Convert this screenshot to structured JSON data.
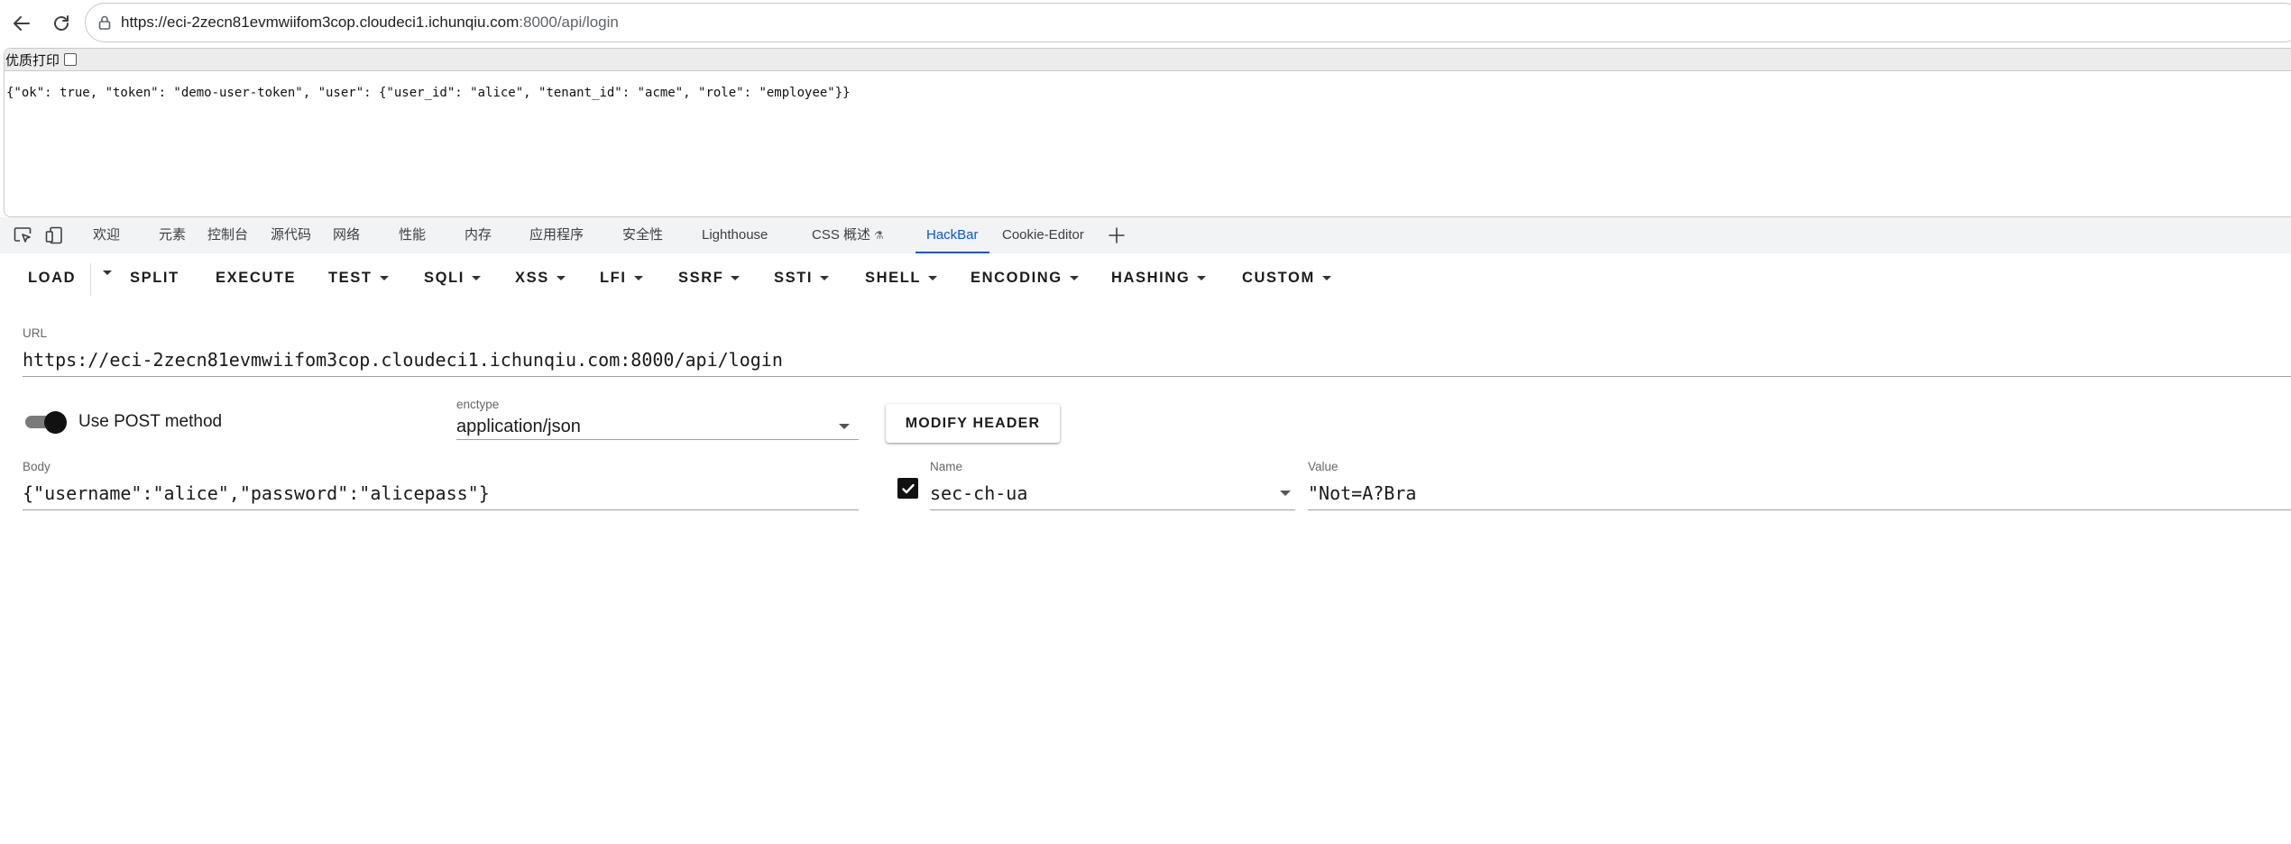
{
  "browser": {
    "url_main": "https://eci-2zecn81evmwiifom3cop.cloudeci1.ichunqiu.com",
    "url_rest": ":8000/api/login"
  },
  "page": {
    "print_label": "优质打印",
    "json_text": "{\"ok\": true, \"token\": \"demo-user-token\", \"user\": {\"user_id\": \"alice\", \"tenant_id\": \"acme\", \"role\": \"employee\"}}"
  },
  "devtools": {
    "tabs": [
      "欢迎",
      "元素",
      "控制台",
      "源代码",
      "网络",
      "性能",
      "内存",
      "应用程序",
      "安全性",
      "Lighthouse",
      "CSS 概述",
      "HackBar",
      "Cookie-Editor"
    ],
    "active_tab": "HackBar"
  },
  "hackbar": {
    "menu": {
      "load": "LOAD",
      "split": "SPLIT",
      "execute": "EXECUTE",
      "test": "TEST",
      "sqli": "SQLI",
      "xss": "XSS",
      "lfi": "LFI",
      "ssrf": "SSRF",
      "ssti": "SSTI",
      "shell": "SHELL",
      "encoding": "ENCODING",
      "hashing": "HASHING",
      "custom": "CUSTOM"
    },
    "url_label": "URL",
    "url_value": "https://eci-2zecn81evmwiifom3cop.cloudeci1.ichunqiu.com:8000/api/login",
    "post_label": "Use POST method",
    "post_enabled": true,
    "enctype_label": "enctype",
    "enctype_value": "application/json",
    "modify_header_label": "MODIFY HEADER",
    "body_label": "Body",
    "body_value": "{\"username\":\"alice\",\"password\":\"alicepass\"}",
    "header": {
      "enabled": true,
      "name_label": "Name",
      "name_value": "sec-ch-ua",
      "value_label": "Value",
      "value_value": "\"Not=A?Bra"
    }
  },
  "colors": {
    "accent": "#0b57d0",
    "devtools_bar": "#f1f3f4",
    "toggle_knob": "#111111"
  },
  "icons": [
    "back-arrow-icon",
    "reload-icon",
    "site-info-icon",
    "inspect-element-icon",
    "device-toggle-icon",
    "add-tab-icon",
    "chevron-down-icon",
    "checkmark-icon"
  ]
}
